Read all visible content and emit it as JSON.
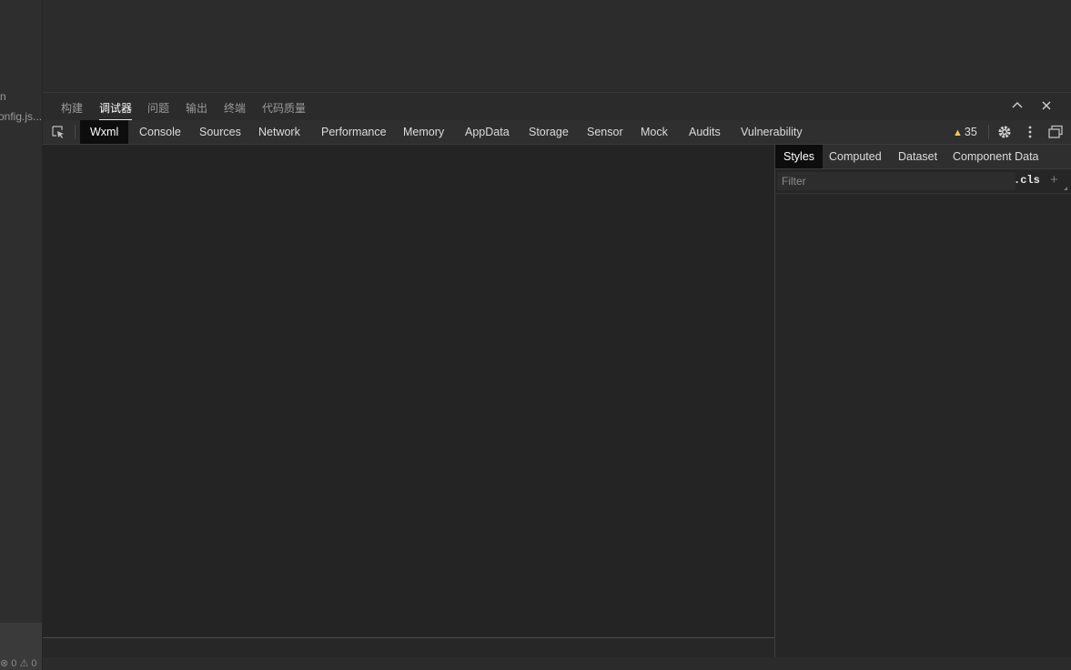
{
  "left_sidebar": {
    "line1": "n",
    "line2": "onfig.js...",
    "status": "⊗ 0  ⚠ 0"
  },
  "panel": {
    "tabs": [
      {
        "label": "构建",
        "active": false
      },
      {
        "label": "调试器",
        "active": true
      },
      {
        "label": "问题",
        "active": false
      },
      {
        "label": "输出",
        "active": false
      },
      {
        "label": "终端",
        "active": false
      },
      {
        "label": "代码质量",
        "active": false
      }
    ]
  },
  "devtools": {
    "tabs": [
      {
        "label": "Wxml",
        "active": true
      },
      {
        "label": "Console"
      },
      {
        "label": "Sources"
      },
      {
        "label": "Network"
      },
      {
        "label": "Performance"
      },
      {
        "label": "Memory"
      },
      {
        "label": "AppData"
      },
      {
        "label": "Storage"
      },
      {
        "label": "Sensor"
      },
      {
        "label": "Mock"
      },
      {
        "label": "Audits"
      },
      {
        "label": "Vulnerability"
      }
    ],
    "warning_count": "35",
    "warning_color": "#f2c94c"
  },
  "side_panel": {
    "tabs": [
      {
        "label": "Styles",
        "active": true
      },
      {
        "label": "Computed"
      },
      {
        "label": "Dataset"
      },
      {
        "label": "Component Data"
      }
    ],
    "filter_placeholder": "Filter",
    "cls_label": ".cls",
    "plus_label": "+"
  }
}
